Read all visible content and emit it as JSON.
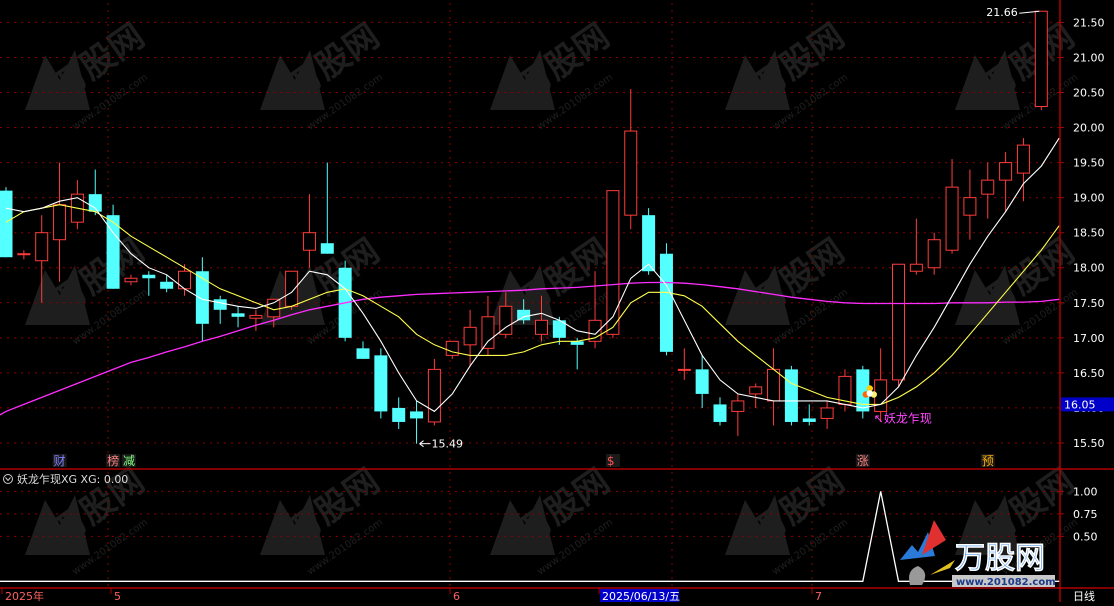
{
  "colors": {
    "background": "#000000",
    "frame": "#b00000",
    "grid": "#8a0000",
    "up": "#ff3b3b",
    "down": "#54ffff",
    "ma_fast": "#ffffff",
    "ma_mid": "#ffff4c",
    "ma_slow": "#ff2cff",
    "axis_text": "#ffffff",
    "current_price_bg": "#0000c8",
    "signal_text": "#ff44ff",
    "xg_line": "#ffffff"
  },
  "watermark": {
    "logo_text": "万股网",
    "url_text": "www.201082.com"
  },
  "chart_data": [
    {
      "type": "candlestick",
      "y_axis_ticks": [
        "15.50",
        "16.00",
        "16.50",
        "17.00",
        "17.50",
        "18.00",
        "18.50",
        "19.00",
        "19.50",
        "20.00",
        "20.50",
        "21.00",
        "21.50"
      ],
      "ylim": [
        15.2,
        21.72
      ],
      "current_price": "16.05",
      "high_annotation": "21.66",
      "low_annotation": "15.49",
      "signal_label": "妖龙乍现",
      "x_labels": [
        "2025年",
        "5",
        "6",
        "2025/06/13/五",
        "7",
        "日线"
      ],
      "event_markers": [
        {
          "label": "财",
          "index": 3
        },
        {
          "label": "榜",
          "index": 6
        },
        {
          "label": "减",
          "index": 7
        },
        {
          "label": "$",
          "index": 34
        },
        {
          "label": "涨",
          "index": 48
        },
        {
          "label": "预",
          "index": 55
        }
      ],
      "candles": [
        {
          "o": 19.1,
          "h": 19.15,
          "l": 18.15,
          "c": 18.15
        },
        {
          "o": 18.2,
          "h": 18.25,
          "l": 18.12,
          "c": 18.2
        },
        {
          "o": 18.1,
          "h": 18.75,
          "l": 17.5,
          "c": 18.5
        },
        {
          "o": 18.4,
          "h": 19.5,
          "l": 17.8,
          "c": 18.9
        },
        {
          "o": 18.65,
          "h": 19.25,
          "l": 18.55,
          "c": 19.05
        },
        {
          "o": 19.05,
          "h": 19.4,
          "l": 18.75,
          "c": 18.8
        },
        {
          "o": 18.75,
          "h": 18.9,
          "l": 17.7,
          "c": 17.7
        },
        {
          "o": 17.8,
          "h": 17.9,
          "l": 17.75,
          "c": 17.85
        },
        {
          "o": 17.9,
          "h": 17.95,
          "l": 17.6,
          "c": 17.85
        },
        {
          "o": 17.8,
          "h": 17.9,
          "l": 17.65,
          "c": 17.7
        },
        {
          "o": 17.7,
          "h": 18.05,
          "l": 17.6,
          "c": 17.95
        },
        {
          "o": 17.95,
          "h": 18.15,
          "l": 16.95,
          "c": 17.2
        },
        {
          "o": 17.55,
          "h": 17.6,
          "l": 17.2,
          "c": 17.4
        },
        {
          "o": 17.35,
          "h": 17.45,
          "l": 17.15,
          "c": 17.3
        },
        {
          "o": 17.28,
          "h": 17.4,
          "l": 17.1,
          "c": 17.32
        },
        {
          "o": 17.3,
          "h": 17.5,
          "l": 17.15,
          "c": 17.55
        },
        {
          "o": 17.45,
          "h": 17.95,
          "l": 17.4,
          "c": 17.95
        },
        {
          "o": 18.25,
          "h": 19.05,
          "l": 18.0,
          "c": 18.5
        },
        {
          "o": 18.35,
          "h": 19.5,
          "l": 18.2,
          "c": 18.2
        },
        {
          "o": 18.0,
          "h": 18.1,
          "l": 16.95,
          "c": 17.0
        },
        {
          "o": 16.85,
          "h": 16.95,
          "l": 16.7,
          "c": 16.7
        },
        {
          "o": 16.75,
          "h": 16.85,
          "l": 15.85,
          "c": 15.95
        },
        {
          "o": 16.0,
          "h": 16.15,
          "l": 15.7,
          "c": 15.8
        },
        {
          "o": 15.95,
          "h": 16.1,
          "l": 15.49,
          "c": 15.85
        },
        {
          "o": 15.8,
          "h": 16.7,
          "l": 15.75,
          "c": 16.55
        },
        {
          "o": 16.75,
          "h": 16.95,
          "l": 16.7,
          "c": 16.95
        },
        {
          "o": 16.9,
          "h": 17.4,
          "l": 16.6,
          "c": 17.15
        },
        {
          "o": 16.85,
          "h": 17.6,
          "l": 16.75,
          "c": 17.3
        },
        {
          "o": 17.05,
          "h": 17.65,
          "l": 17.0,
          "c": 17.45
        },
        {
          "o": 17.4,
          "h": 17.55,
          "l": 17.2,
          "c": 17.25
        },
        {
          "o": 17.05,
          "h": 17.6,
          "l": 16.95,
          "c": 17.25
        },
        {
          "o": 17.25,
          "h": 17.3,
          "l": 16.9,
          "c": 17.0
        },
        {
          "o": 16.95,
          "h": 17.0,
          "l": 16.55,
          "c": 16.9
        },
        {
          "o": 16.95,
          "h": 17.95,
          "l": 16.85,
          "c": 17.25
        },
        {
          "o": 17.05,
          "h": 19.1,
          "l": 17.0,
          "c": 19.1
        },
        {
          "o": 18.75,
          "h": 20.55,
          "l": 18.55,
          "c": 19.95
        },
        {
          "o": 18.75,
          "h": 18.85,
          "l": 17.9,
          "c": 17.95
        },
        {
          "o": 18.2,
          "h": 18.35,
          "l": 16.75,
          "c": 16.8
        },
        {
          "o": 16.55,
          "h": 16.85,
          "l": 16.4,
          "c": 16.55
        },
        {
          "o": 16.55,
          "h": 16.75,
          "l": 16.0,
          "c": 16.2
        },
        {
          "o": 16.05,
          "h": 16.15,
          "l": 15.75,
          "c": 15.8
        },
        {
          "o": 15.95,
          "h": 16.2,
          "l": 15.6,
          "c": 16.1
        },
        {
          "o": 16.2,
          "h": 16.35,
          "l": 16.0,
          "c": 16.3
        },
        {
          "o": 16.1,
          "h": 16.85,
          "l": 15.75,
          "c": 16.55
        },
        {
          "o": 16.55,
          "h": 16.6,
          "l": 15.75,
          "c": 15.8
        },
        {
          "o": 15.85,
          "h": 16.05,
          "l": 15.75,
          "c": 15.8
        },
        {
          "o": 15.85,
          "h": 16.1,
          "l": 15.7,
          "c": 16.0
        },
        {
          "o": 16.05,
          "h": 16.55,
          "l": 15.95,
          "c": 16.45
        },
        {
          "o": 16.55,
          "h": 16.6,
          "l": 15.85,
          "c": 15.95
        },
        {
          "o": 15.95,
          "h": 16.85,
          "l": 15.8,
          "c": 16.4
        },
        {
          "o": 16.4,
          "h": 18.05,
          "l": 16.3,
          "c": 18.05
        },
        {
          "o": 17.95,
          "h": 18.7,
          "l": 17.9,
          "c": 18.05
        },
        {
          "o": 18.0,
          "h": 18.5,
          "l": 17.9,
          "c": 18.4
        },
        {
          "o": 18.25,
          "h": 19.55,
          "l": 18.2,
          "c": 19.15
        },
        {
          "o": 18.75,
          "h": 19.4,
          "l": 18.4,
          "c": 19.0
        },
        {
          "o": 19.05,
          "h": 19.5,
          "l": 18.7,
          "c": 19.25
        },
        {
          "o": 19.25,
          "h": 19.65,
          "l": 18.8,
          "c": 19.5
        },
        {
          "o": 19.35,
          "h": 19.85,
          "l": 18.95,
          "c": 19.75
        },
        {
          "o": 20.3,
          "h": 21.66,
          "l": 20.25,
          "c": 21.66
        }
      ],
      "ma_fast": [
        18.85,
        18.8,
        18.85,
        18.95,
        19.0,
        18.85,
        18.5,
        18.2,
        18.0,
        17.9,
        17.7,
        17.55,
        17.5,
        17.45,
        17.42,
        17.5,
        17.65,
        17.95,
        17.9,
        17.7,
        17.35,
        16.95,
        16.5,
        16.1,
        15.95,
        16.2,
        16.6,
        16.95,
        17.15,
        17.3,
        17.35,
        17.25,
        17.1,
        17.05,
        17.3,
        17.85,
        18.05,
        17.75,
        17.25,
        16.75,
        16.4,
        16.2,
        16.15,
        16.1,
        16.1,
        16.1,
        16.1,
        16.05,
        16.0,
        16.05,
        16.3,
        16.75,
        17.15,
        17.6,
        18.05,
        18.45,
        18.8,
        19.2,
        19.45,
        19.85
      ],
      "ma_mid": [
        18.65,
        18.8,
        18.85,
        18.9,
        18.85,
        18.8,
        18.65,
        18.45,
        18.3,
        18.15,
        18.0,
        17.85,
        17.7,
        17.6,
        17.5,
        17.4,
        17.45,
        17.55,
        17.65,
        17.7,
        17.6,
        17.45,
        17.3,
        17.05,
        16.9,
        16.8,
        16.75,
        16.75,
        16.75,
        16.8,
        16.9,
        16.95,
        16.95,
        17.0,
        17.15,
        17.5,
        17.65,
        17.65,
        17.6,
        17.45,
        17.2,
        16.95,
        16.75,
        16.55,
        16.35,
        16.25,
        16.15,
        16.1,
        16.05,
        16.05,
        16.15,
        16.3,
        16.5,
        16.75,
        17.05,
        17.35,
        17.65,
        17.95,
        18.25,
        18.6
      ],
      "ma_slow": [
        15.95,
        16.05,
        16.15,
        16.25,
        16.35,
        16.45,
        16.55,
        16.65,
        16.72,
        16.8,
        16.87,
        16.95,
        17.02,
        17.1,
        17.18,
        17.25,
        17.33,
        17.4,
        17.45,
        17.5,
        17.55,
        17.58,
        17.6,
        17.62,
        17.63,
        17.64,
        17.65,
        17.66,
        17.67,
        17.68,
        17.7,
        17.71,
        17.72,
        17.74,
        17.76,
        17.78,
        17.79,
        17.79,
        17.78,
        17.76,
        17.73,
        17.7,
        17.66,
        17.62,
        17.58,
        17.55,
        17.52,
        17.5,
        17.49,
        17.49,
        17.49,
        17.49,
        17.49,
        17.5,
        17.5,
        17.5,
        17.51,
        17.51,
        17.52,
        17.55
      ]
    },
    {
      "type": "line",
      "title": "妖龙乍现XG  XG: 0.00",
      "y_axis_ticks": [
        "1.00",
        "0.75",
        "0.50"
      ],
      "ylim": [
        -0.03,
        1.06
      ],
      "values": [
        0,
        0,
        0,
        0,
        0,
        0,
        0,
        0,
        0,
        0,
        0,
        0,
        0,
        0,
        0,
        0,
        0,
        0,
        0,
        0,
        0,
        0,
        0,
        0,
        0,
        0,
        0,
        0,
        0,
        0,
        0,
        0,
        0,
        0,
        0,
        0,
        0,
        0,
        0,
        0,
        0,
        0,
        0,
        0,
        0,
        0,
        0,
        0,
        0,
        1,
        0,
        0,
        0,
        0,
        0,
        0,
        0,
        0,
        0,
        0
      ]
    }
  ]
}
